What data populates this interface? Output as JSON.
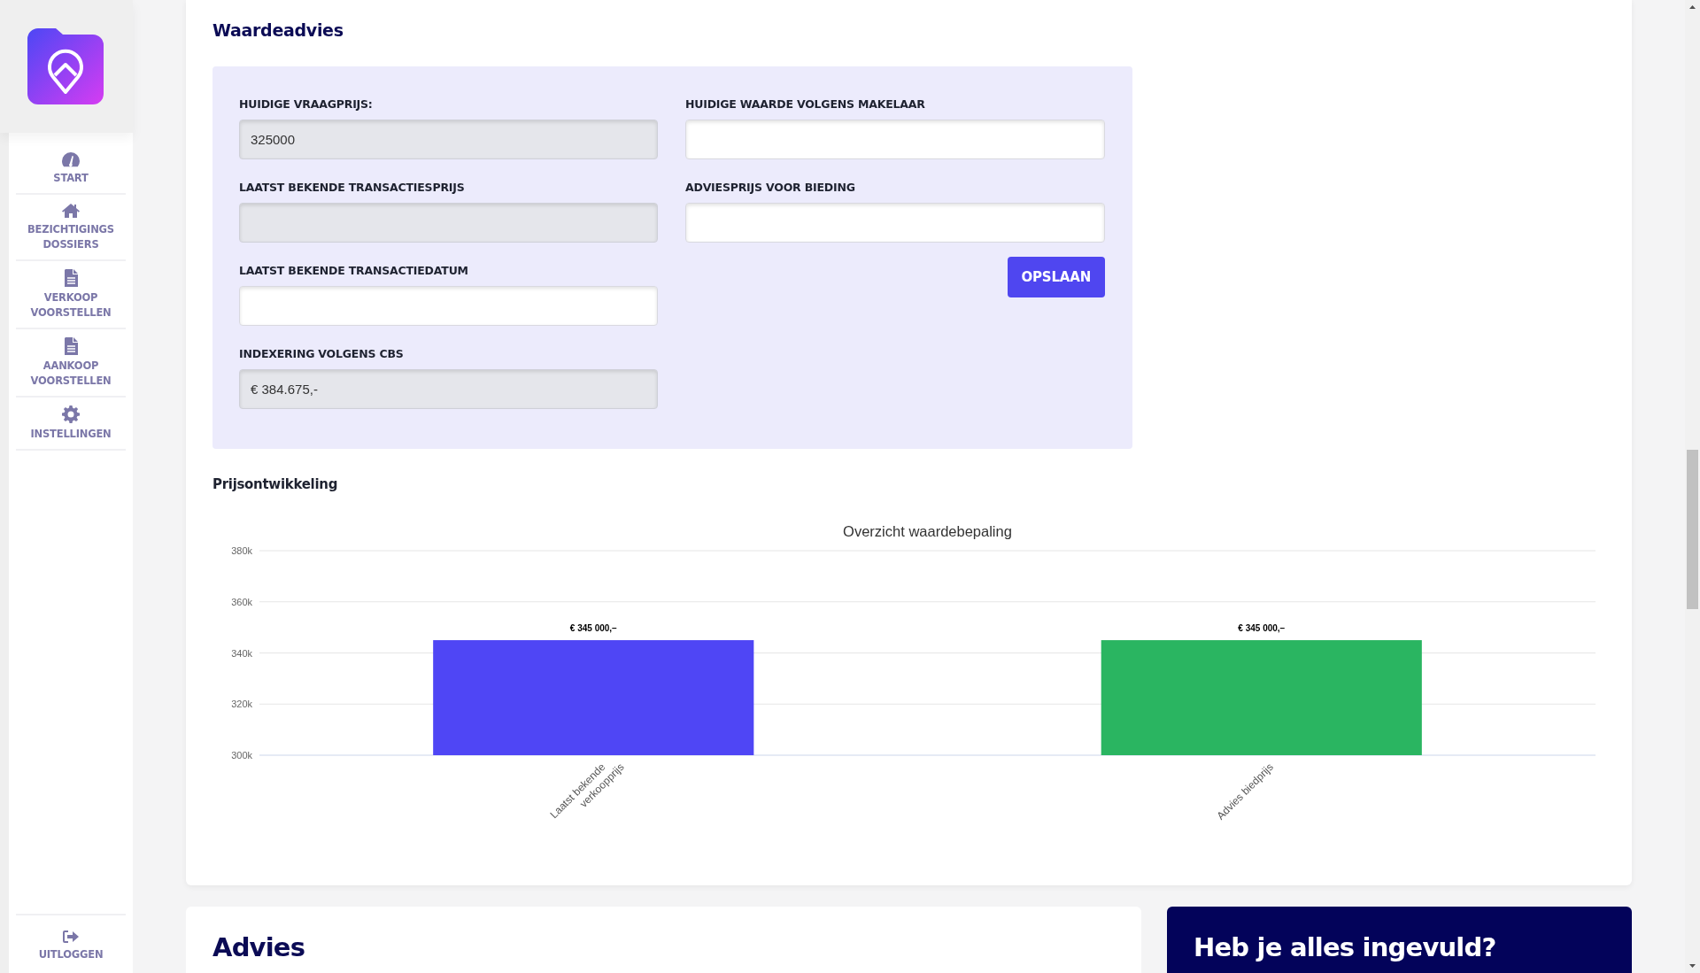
{
  "sidebar": {
    "items": [
      {
        "label": "START"
      },
      {
        "label": "BEZICHTIGINGS DOSSIERS"
      },
      {
        "label": "VERKOOP VOORSTELLEN"
      },
      {
        "label": "AANKOOP VOORSTELLEN"
      },
      {
        "label": "INSTELLINGEN"
      }
    ],
    "logout": {
      "label": "UITLOGGEN"
    }
  },
  "waardeadvies": {
    "title": "Waardeadvies",
    "left_fields": [
      {
        "label": "HUIDIGE VRAAGPRIJS:",
        "value": "325000",
        "disabled": true
      },
      {
        "label": "LAATST BEKENDE TRANSACTIESPRIJS",
        "disabled": true
      },
      {
        "label": "LAATST BEKENDE TRANSACTIEDATUM",
        "disabled": false
      },
      {
        "label": "INDEXERING VOLGENS CBS",
        "value": "€ 384.675,-",
        "disabled": true
      }
    ],
    "right_fields": [
      {
        "label": "HUIDIGE WAARDE VOLGENS MAKELAAR",
        "disabled": false
      },
      {
        "label": "ADVIESPRIJS VOOR BIEDING",
        "disabled": false
      }
    ],
    "save_button": "OPSLAAN"
  },
  "prijsontwikkeling": {
    "title": "Prijsontwikkeling",
    "chart_data": {
      "type": "bar",
      "title": "Overzicht waardebepaling",
      "categories": [
        "Laatst bekende verkoopprijs",
        "Advies biedprijs"
      ],
      "values": [
        345000,
        345000
      ],
      "colors": [
        "#4f46f5",
        "#2ab561"
      ],
      "grid": true,
      "ylim": [
        300000,
        380000
      ],
      "yticks": [
        {
          "value": 300000,
          "label": "300k"
        },
        {
          "value": 320000,
          "label": "320k"
        },
        {
          "value": 340000,
          "label": "340k"
        },
        {
          "value": 360000,
          "label": "360k"
        },
        {
          "value": 380000,
          "label": "380k"
        }
      ],
      "value_labels": [
        "€ 345 000,–",
        "€ 345 000,–"
      ]
    }
  },
  "advies": {
    "title": "Advies"
  },
  "checklist": {
    "title": "Heb je alles ingevuld?"
  }
}
